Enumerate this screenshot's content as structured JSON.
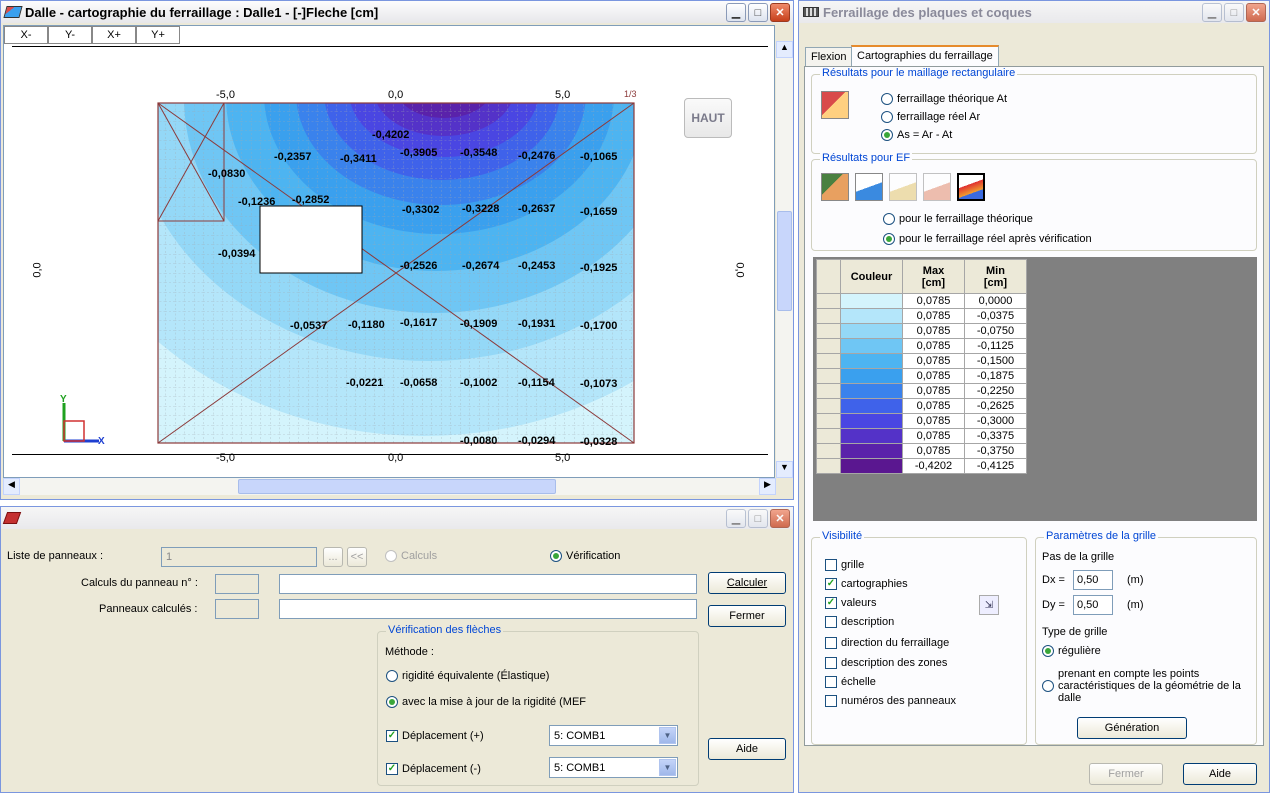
{
  "map_window": {
    "title": "Dalle - cartographie du ferraillage : Dalle1 - [-]Fleche [cm]",
    "view_buttons": [
      "X-",
      "Y-",
      "X+",
      "Y+"
    ],
    "haut_label": "HAUT",
    "ruler_top": [
      "-5,0",
      "0,0",
      "5,0"
    ],
    "ruler_bottom": [
      "-5,0",
      "0,0",
      "5,0"
    ],
    "ruler_left": "0,0",
    "ruler_right": "0,0",
    "corner_mark": "1/3",
    "axis_x": "X",
    "axis_y": "Y",
    "values": [
      "-0,4202",
      "-0,2357",
      "-0,3411",
      "-0,3905",
      "-0,3548",
      "-0,2476",
      "-0,1065",
      "-0,0830",
      "-0,1236",
      "-0,2852",
      "-0,3302",
      "-0,3228",
      "-0,2637",
      "-0,1659",
      "-0,0394",
      "-0,2526",
      "-0,2674",
      "-0,2453",
      "-0,1925",
      "-0,0537",
      "-0,1180",
      "-0,1617",
      "-0,1909",
      "-0,1931",
      "-0,1700",
      "-0,0221",
      "-0,0658",
      "-0,1002",
      "-0,1154",
      "-0,1073",
      "-0,0080",
      "-0,0294",
      "-0,0328"
    ]
  },
  "panel_window": {
    "liste_label": "Liste de panneaux :",
    "liste_value": "1",
    "calculs_radio": "Calculs",
    "verif_radio": "Vérification",
    "calc_panneau_label": "Calculs du panneau n° :",
    "panneaux_calc_label": "Panneaux calculés :",
    "calculer_btn": "Calculer",
    "fermer_btn": "Fermer",
    "aide_btn": "Aide",
    "verif_group": "Vérification des flèches",
    "methode_label": "Méthode :",
    "rigidite_radio": "rigidité équivalente (Élastique)",
    "mef_radio": "avec la mise à jour de la rigidité (MEF",
    "dep_plus": "Déplacement (+)",
    "dep_moins": "Déplacement (-)",
    "combo1": "5: COMB1",
    "combo2": "5: COMB1",
    "browse_btn": "...",
    "prev_btn": "<<"
  },
  "ferr_window": {
    "title": "Ferraillage des plaques et coques",
    "tabs": [
      "Flexion",
      "Cartographies du ferraillage"
    ],
    "rect_group": "Résultats pour le maillage rectangulaire",
    "rect_radios": [
      "ferraillage théorique At",
      "ferraillage réel Ar",
      "As = Ar - At"
    ],
    "ef_group": "Résultats pour EF",
    "ef_radios": [
      "pour le ferraillage théorique",
      "pour le ferraillage réel après vérification"
    ],
    "table_headers": [
      "Couleur",
      "Max\n[cm]",
      "Min\n[cm]"
    ],
    "table_rows": [
      {
        "color": "#d4f4fc",
        "max": "0,0785",
        "min": "0,0000"
      },
      {
        "color": "#b4e6fa",
        "max": "0,0785",
        "min": "-0,0375"
      },
      {
        "color": "#94d8f7",
        "max": "0,0785",
        "min": "-0,0750"
      },
      {
        "color": "#6fc6f4",
        "max": "0,0785",
        "min": "-0,1125"
      },
      {
        "color": "#4db4f1",
        "max": "0,0785",
        "min": "-0,1500"
      },
      {
        "color": "#3aa0ee",
        "max": "0,0785",
        "min": "-0,1875"
      },
      {
        "color": "#3a82ec",
        "max": "0,0785",
        "min": "-0,2250"
      },
      {
        "color": "#3f62ea",
        "max": "0,0785",
        "min": "-0,2625"
      },
      {
        "color": "#4a46e2",
        "max": "0,0785",
        "min": "-0,3000"
      },
      {
        "color": "#5432c8",
        "max": "0,0785",
        "min": "-0,3375"
      },
      {
        "color": "#5a22aa",
        "max": "0,0785",
        "min": "-0,3750"
      },
      {
        "color": "#5a1790",
        "max": "-0,4202",
        "min": "-0,4125"
      }
    ],
    "visibilite_group": "Visibilité",
    "vis_items": [
      {
        "label": "grille",
        "checked": false
      },
      {
        "label": "cartographies",
        "checked": true
      },
      {
        "label": "valeurs",
        "checked": true
      },
      {
        "label": "description",
        "checked": false
      },
      {
        "label": "direction du ferraillage",
        "checked": false
      },
      {
        "label": "description des zones",
        "checked": false
      },
      {
        "label": "échelle",
        "checked": false
      },
      {
        "label": "numéros des panneaux",
        "checked": false
      }
    ],
    "grid_group": "Paramètres de la grille",
    "pas_label": "Pas de la grille",
    "dx_label": "Dx =",
    "dx_value": "0,50",
    "dy_label": "Dy =",
    "dy_value": "0,50",
    "unit": "(m)",
    "type_label": "Type de grille",
    "reguliere": "régulière",
    "points_radio": "prenant en compte les points caractéristiques de la géométrie de la dalle",
    "generation_btn": "Génération",
    "fermer_btn": "Fermer",
    "aide_btn": "Aide"
  },
  "icons": [
    "plate-map-icon",
    "minimize-icon",
    "maximize-icon",
    "close-icon",
    "scroll-up-icon",
    "scroll-down-icon",
    "scroll-left-icon",
    "scroll-right-icon",
    "eraser-icon",
    "rebar-icon",
    "calc-settings-icon",
    "dropdown-arrow-icon"
  ]
}
